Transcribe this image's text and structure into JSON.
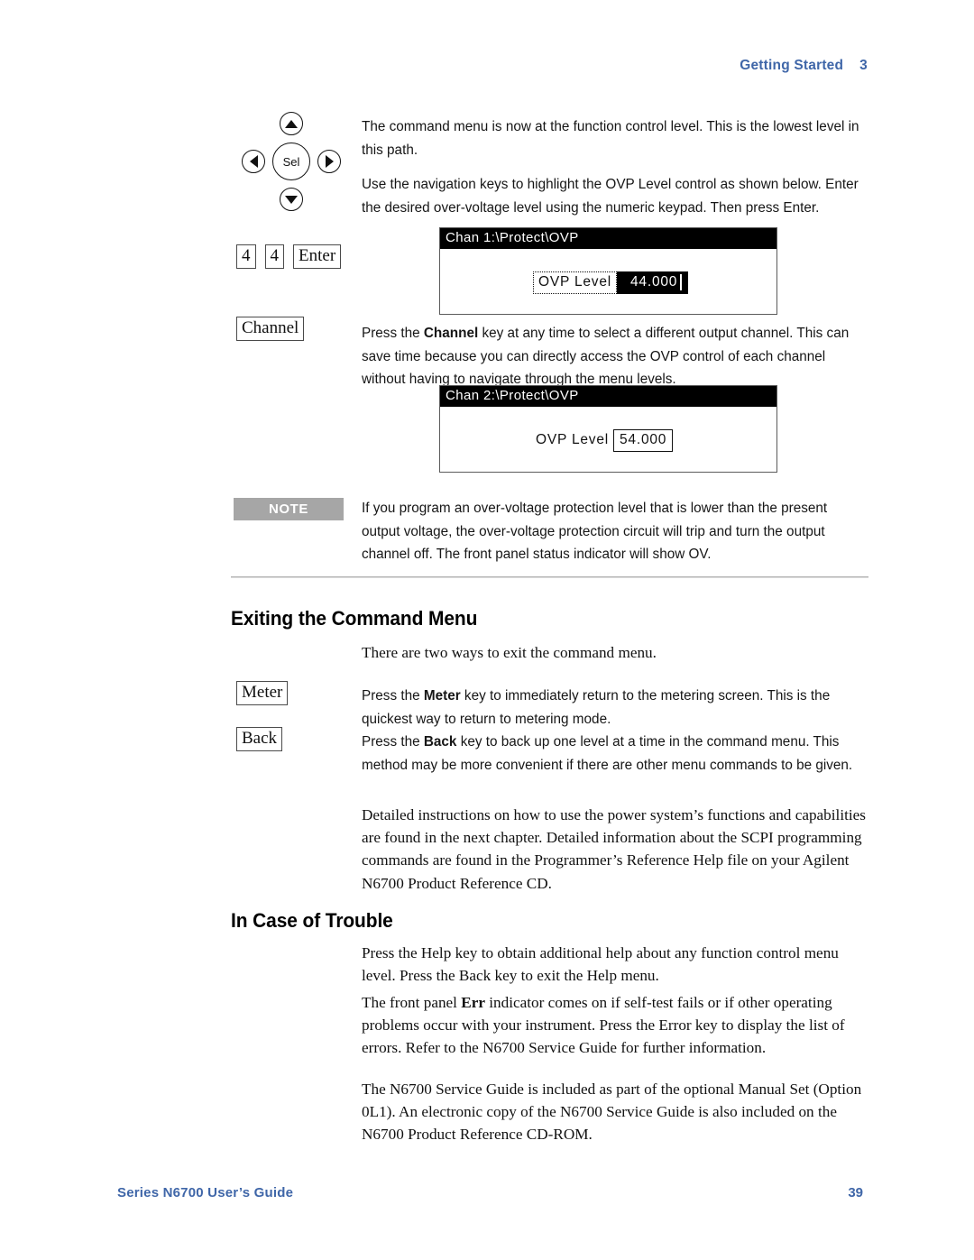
{
  "page": {
    "running_head": "Getting Started",
    "chapter_number": "3",
    "accent_color": "#3f66a8",
    "note_tag_color": "#a6a6a6"
  },
  "nav_keys": {
    "up": "up-arrow",
    "down": "down-arrow",
    "left": "left-arrow",
    "right": "right-arrow",
    "select_label": "Sel"
  },
  "keys": {
    "digit_1": "4",
    "digit_2": "4",
    "enter": "Enter",
    "channel": "Channel",
    "meter": "Meter",
    "back": "Back"
  },
  "paragraphs": {
    "p1": "The command menu is now at the function control level. This is the lowest level in this path.",
    "p2": "Use the navigation keys to highlight the OVP Level control as shown below. Enter the desired over-voltage level using the numeric keypad. Then press Enter.",
    "p3_pre": "Press the ",
    "p3_bold": "Channel",
    "p3_post": " key at any time to select a different output channel. This can save time because you can directly access the OVP control of each channel without having to navigate through the menu levels.",
    "note": "If you program an over-voltage protection level that is lower than the present output voltage, the over-voltage protection circuit will trip and turn the output channel off. The front panel status indicator will show OV.",
    "exit_intro": "There are two ways to exit the command menu.",
    "meter_pre": "Press the ",
    "meter_bold": "Meter",
    "meter_post": " key to immediately return to the metering screen. This is the quickest way to return to metering mode.",
    "back_pre": "Press the ",
    "back_bold": "Back",
    "back_post": " key to back up one level at a time in the command menu. This method may be more convenient if there are other menu commands to be given.",
    "detailed": "Detailed instructions on how to use the power system’s functions and capabilities are found in the next chapter. Detailed information about the SCPI programming commands are found in the Programmer’s Reference Help file on your Agilent N6700 Product Reference CD.",
    "help": "Press the Help key to obtain additional help about any function control menu level. Press the Back key to exit the Help menu.",
    "err_pre": "The front panel ",
    "err_bold": "Err",
    "err_post": " indicator comes on if self-test fails or if other operating problems occur with your instrument. Press the Error key to display the list of errors. Refer to the N6700 Service Guide for further information.",
    "service_guide": "The N6700 Service Guide is included as part of the optional Manual Set (Option 0L1). An electronic copy of the N6700 Service Guide is also included on the N6700 Product Reference CD-ROM."
  },
  "note": {
    "tag": "NOTE"
  },
  "headings": {
    "exiting": "Exiting the Command Menu",
    "trouble": "In Case of Trouble"
  },
  "lcd1": {
    "title": "Chan 1:\\Protect\\OVP",
    "label": "OVP Level",
    "value": "44.000"
  },
  "lcd2": {
    "title": "Chan 2:\\Protect\\OVP",
    "label": "OVP Level",
    "value": "54.000"
  },
  "footer": {
    "left": "Series N6700 User’s Guide",
    "page_number": "39"
  }
}
